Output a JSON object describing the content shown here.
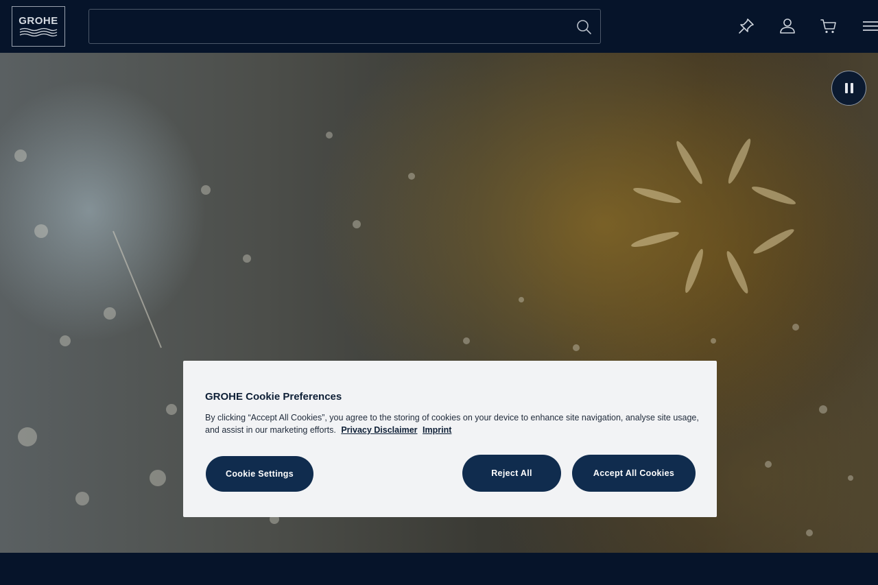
{
  "brand": {
    "logo_text": "GROHE"
  },
  "header": {
    "search": {
      "value": "",
      "placeholder": ""
    },
    "icons": [
      "search-icon",
      "pin-icon",
      "user-icon",
      "cart-icon",
      "menu-icon"
    ]
  },
  "hero": {
    "media_control": "pause-icon"
  },
  "cookie": {
    "title": "GROHE Cookie Preferences",
    "text": "By clicking “Accept All Cookies”, you agree to the storing of cookies on your device to enhance site navigation, analyse site usage, and assist in our marketing efforts.",
    "privacy_link": "Privacy Disclaimer",
    "imprint_link": "Imprint",
    "settings_label": "Cookie Settings",
    "reject_label": "Reject All",
    "accept_label": "Accept All Cookies"
  },
  "colors": {
    "header_bg": "#06142a",
    "button_bg": "#102c4e",
    "dialog_bg": "#f2f3f5"
  }
}
